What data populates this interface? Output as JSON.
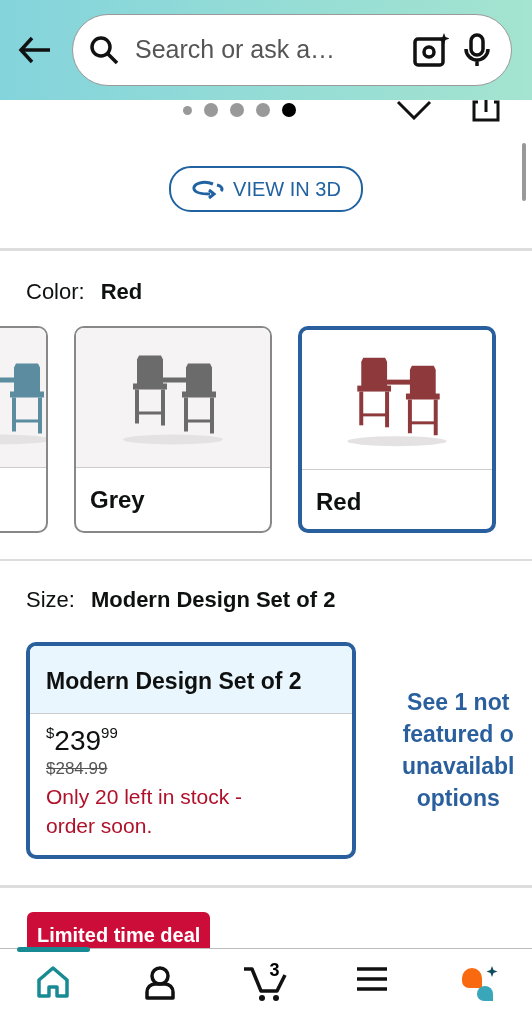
{
  "search": {
    "placeholder": "Search or ask a…"
  },
  "carousel_dots": [
    {
      "selected": false
    },
    {
      "selected": false
    },
    {
      "selected": false
    },
    {
      "selected": false
    },
    {
      "selected": true
    }
  ],
  "view_3d_button": "VIEW IN 3D",
  "color": {
    "label": "Color:",
    "value": "Red"
  },
  "swatches": [
    {
      "color": "#5b8ca0",
      "selected": false
    },
    {
      "label": "Grey",
      "color": "#6b6b6b",
      "selected": false
    },
    {
      "label": "Red",
      "color": "#8e3a3c",
      "selected": true
    }
  ],
  "size": {
    "label": "Size:",
    "value": "Modern Design Set of 2"
  },
  "size_option": {
    "title": "Modern Design Set of 2",
    "currency": "$",
    "price_whole": "239",
    "price_fraction": "99",
    "list_price": "$284.99",
    "stock": "Only 20 left in stock - order soon.",
    "selected": true
  },
  "unavailable_link": "See 1 not\nfeatured o\nunavailabl\noptions",
  "deal_badge": "Limited time deal",
  "bottom_nav": [
    {
      "kind": "home",
      "selected": true
    },
    {
      "kind": "account",
      "selected": false
    },
    {
      "kind": "cart",
      "count": "3",
      "selected": false
    },
    {
      "kind": "menu",
      "selected": false
    },
    {
      "kind": "assistant",
      "selected": false
    }
  ]
}
